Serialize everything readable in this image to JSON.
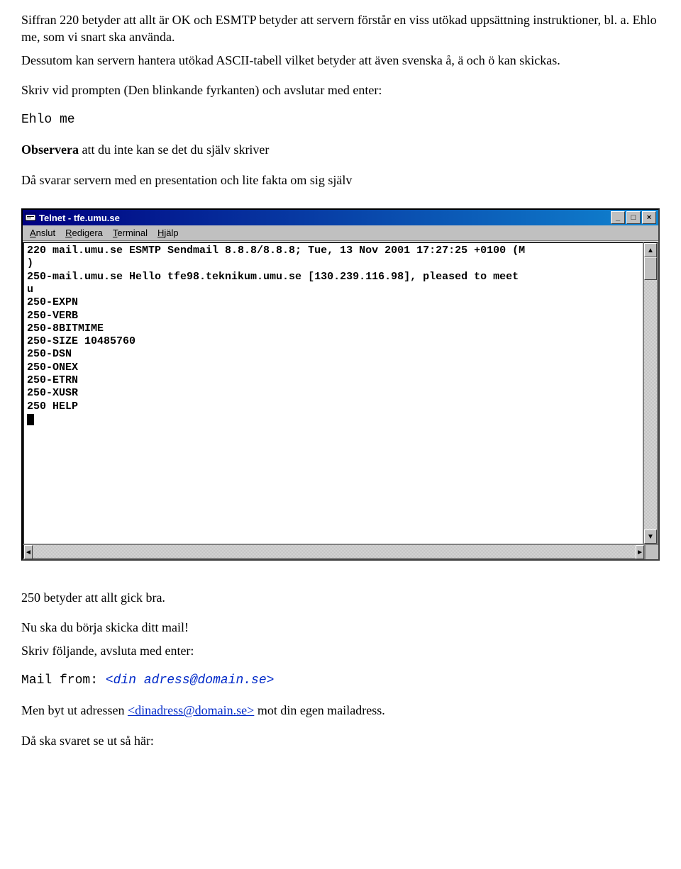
{
  "para1": "Siffran 220 betyder att allt är OK och ESMTP betyder att servern förstår en viss utökad uppsättning instruktioner, bl. a. Ehlo me, som vi snart ska använda.",
  "para2": "Dessutom kan servern hantera utökad ASCII-tabell vilket betyder att även svenska å, ä och ö kan skickas.",
  "para3": "Skriv vid prompten (Den blinkande fyrkanten) och avslutar med enter:",
  "cmd1": "Ehlo me",
  "para4a": "Observera",
  "para4b": " att du inte kan se det du själv skriver",
  "para5": "Då svarar servern med en presentation och lite fakta om sig själv",
  "window": {
    "title": "Telnet - tfe.umu.se",
    "menu": {
      "m1a": "A",
      "m1b": "nslut",
      "m2a": "R",
      "m2b": "edigera",
      "m3a": "T",
      "m3b": "erminal",
      "m4a": "H",
      "m4b": "jälp"
    },
    "btn_min": "_",
    "btn_max": "□",
    "btn_close": "×",
    "lines": [
      "220 mail.umu.se ESMTP Sendmail 8.8.8/8.8.8; Tue, 13 Nov 2001 17:27:25 +0100 (M",
      ")",
      "250-mail.umu.se Hello tfe98.teknikum.umu.se [130.239.116.98], pleased to meet",
      "u",
      "250-EXPN",
      "250-VERB",
      "250-8BITMIME",
      "250-SIZE 10485760",
      "250-DSN",
      "250-ONEX",
      "250-ETRN",
      "250-XUSR",
      "250 HELP"
    ],
    "arrow_up": "▲",
    "arrow_down": "▼",
    "arrow_left": "◄",
    "arrow_right": "►"
  },
  "para6": "250 betyder att allt gick bra.",
  "para7": "Nu ska du börja skicka ditt mail!",
  "para8": "Skriv följande, avsluta med enter:",
  "cmd2a": "Mail from: ",
  "cmd2b": "<din adress@domain.se>",
  "para9a": "Men byt ut adressen ",
  "para9b": "<dinadress@domain.se>",
  "para9c": " mot din egen mailadress.",
  "para10": "Då ska svaret se ut så här:"
}
